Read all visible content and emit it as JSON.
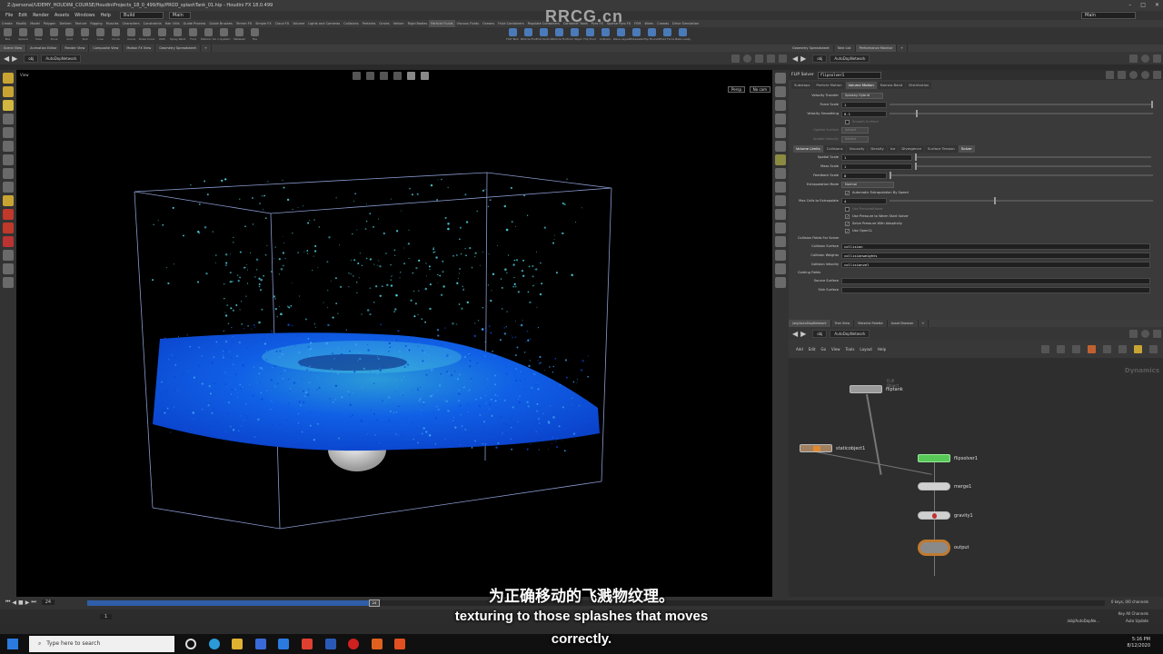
{
  "window": {
    "title": "Z:/personal/UDEMY_HOUDINI_COURSE/HoudiniProjects_18_0_499/flip/PROD_splashTank_01.hip - Houdini FX 18.0.499",
    "desktop": "Build",
    "main": "Main"
  },
  "menu": [
    "File",
    "Edit",
    "Render",
    "Assets",
    "Windows",
    "Help"
  ],
  "shelf": {
    "tabs": [
      "Create",
      "Modify",
      "Model",
      "Polygon",
      "Deform",
      "Texture",
      "Rigging",
      "Muscles",
      "Characters",
      "Constraints",
      "Hair Utils",
      "Guide Process",
      "Guide Brushes",
      "Terrain FX",
      "Simple FX",
      "Cloud FX",
      "Volume",
      "Lights and Cameras",
      "Collisions",
      "Particles",
      "Grains",
      "Vellum",
      "Rigid Bodies",
      "Particle Fluids",
      "Viscous Fluids",
      "Oceans",
      "Fluid Containers",
      "Populate Containers",
      "Container Tools",
      "Pyro FX",
      "Sparse Pyro FX",
      "FEM",
      "Wires",
      "Crowds",
      "Drive Simulation"
    ],
    "tools_left": [
      "Box",
      "Sphere",
      "Tube",
      "Torus",
      "Grid",
      "Null",
      "Line",
      "Circle",
      "Curve",
      "Draw Curve",
      "Path",
      "Spray Paint",
      "Font",
      "Platonic Solids",
      "L-System",
      "Metaball",
      "File"
    ],
    "tools_right": [
      "FLIP Tank",
      "Particle Fluid",
      "Emit Particle Fluid",
      "Particle Fluid",
      "From Object",
      "Flip Fluid",
      "Collision",
      "Wave Layer",
      "Whitewater",
      "Flip Boundary",
      "Fluid Force",
      "Make Leaky"
    ]
  },
  "viewport_panel": {
    "tabs": [
      "Scene View",
      "Animation Editor",
      "Render View",
      "Composite View",
      "Motion FX View",
      "Geometry Spreadsheet"
    ],
    "path": "obj",
    "network": "AutoDopNetwork",
    "label": "View",
    "persp": "Persp",
    "camera": "No cam"
  },
  "param_panel": {
    "tabs": [
      "Geometry Spreadsheet",
      "Take List",
      "Performance Monitor"
    ],
    "path": "obj",
    "network": "AutoDopNetwork",
    "node_type": "FLIP Solver",
    "node_name": "flipsolver1",
    "main_tabs": [
      "Substeps",
      "Particle Motion",
      "Volume Motion",
      "Narrow Band",
      "Distribution"
    ],
    "velocity_transfer_label": "Velocity Transfer",
    "velocity_transfer_value": "Splashy Hybrid",
    "force_scale_label": "Force Scale",
    "force_scale_value": "1",
    "velocity_smoothing_label": "Velocity Smoothing",
    "velocity_smoothing_value": "0.1",
    "smooth_surface_label": "Smooth Surface",
    "update_surface_label": "Update Surface",
    "update_surface_value": "Advect",
    "update_velocity_label": "Update Velocity",
    "update_velocity_value": "Advect",
    "sub_tabs": [
      "Volume Limits",
      "Collisions",
      "Viscosity",
      "Density",
      "Ice",
      "Divergence",
      "Surface Tension",
      "Solver"
    ],
    "spatial_scale_label": "Spatial Scale",
    "spatial_scale_value": "1",
    "mass_scale_label": "Mass Scale",
    "mass_scale_value": "1",
    "feedback_scale_label": "Feedback Scale",
    "feedback_scale_value": "0",
    "extrapolation_mode_label": "Extrapolation Mode",
    "extrapolation_mode_value": "Normal",
    "auto_extrap_label": "Automatic Extrapolation By Speed",
    "max_cells_label": "Max Cells to Extrapolate",
    "max_cells_value": "4",
    "use_preconditioner_label": "Use Preconditioner",
    "use_pressure_warm_label": "Use Pressure to Warm Start Solver",
    "solve_pressure_label": "Solve Pressure With Adaptivity",
    "use_opencl_label": "Use OpenCL",
    "collision_fields_label": "Collision Fields For Solver",
    "collision_surface_label": "Collision Surface",
    "collision_surface_value": "collision",
    "collision_weights_label": "Collision Weights",
    "collision_weights_value": "collisionweights",
    "collision_velocity_label": "Collision Velocity",
    "collision_velocity_value": "collisionvel",
    "guiding_fields_label": "Guiding Fields",
    "source_surface_label": "Source Surface",
    "sink_surface_label": "Sink Surface"
  },
  "network_panel": {
    "tabs": [
      "/obj/AutoDopNetwork",
      "Tree View",
      "Material Palette",
      "Asset Browser"
    ],
    "path": "obj",
    "network": "AutoDopNetwork",
    "menus": [
      "Add",
      "Edit",
      "Go",
      "View",
      "Tools",
      "Layout",
      "Help"
    ],
    "context": "Dynamics",
    "nodes": [
      {
        "name": "fliptank",
        "sub": "FLIP Object"
      },
      {
        "name": "staticobject1",
        "sub": ""
      },
      {
        "name": "flipsolver1",
        "sub": ""
      },
      {
        "name": "merge1",
        "sub": ""
      },
      {
        "name": "gravity1",
        "sub": ""
      },
      {
        "name": "output",
        "sub": ""
      }
    ]
  },
  "timeline": {
    "current_frame": "24",
    "start_frame": "1",
    "end_frame": "1",
    "keys_label": "0 keys, 0/0 channels",
    "key_all_label": "Key All Channels",
    "auto_update": "Auto Update",
    "obj_path": "/obj/AutoDopNe..."
  },
  "subtitles": {
    "zh": "为正确移动的飞溅物纹理。",
    "en_line1": "texturing to those splashes that moves",
    "en_line2": "correctly."
  },
  "watermark": "RRCG.cn",
  "taskbar": {
    "search_placeholder": "Type here to search",
    "time": "5:16 PM",
    "date": "8/12/2020"
  },
  "colors": {
    "water_deep": "#0a4ad8",
    "water_foam": "#4fd0e0",
    "node_green": "#57c857",
    "node_orange": "#e08a30",
    "timeline_blue": "#2f5da8"
  }
}
